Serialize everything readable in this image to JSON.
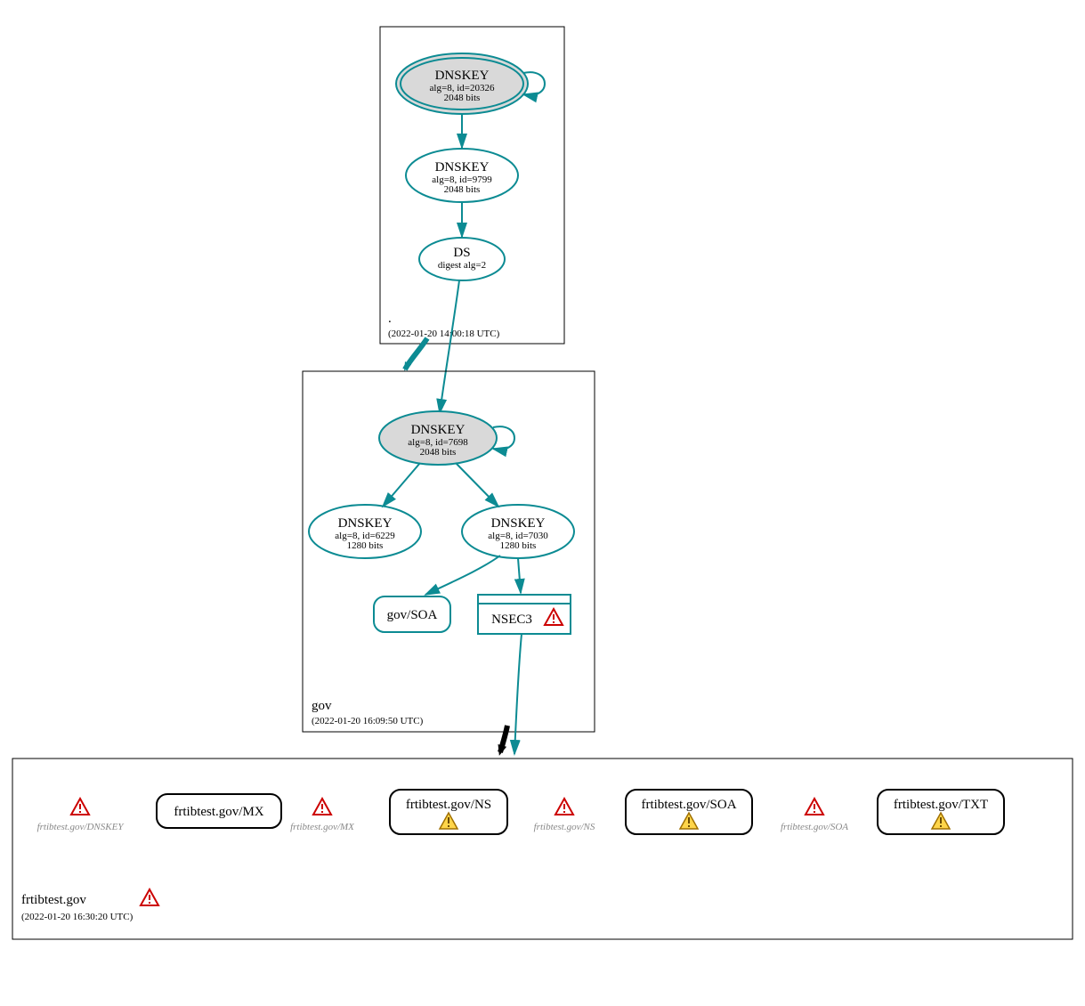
{
  "colors": {
    "teal": "#0c8b93",
    "greyFill": "#d9d9d9",
    "boxStroke": "#000000",
    "ghost": "#888888"
  },
  "zones": {
    "root": {
      "label": ".",
      "timestamp": "(2022-01-20 14:00:18 UTC)"
    },
    "gov": {
      "label": "gov",
      "timestamp": "(2022-01-20 16:09:50 UTC)"
    },
    "frtibtest": {
      "label": "frtibtest.gov",
      "timestamp": "(2022-01-20 16:30:20 UTC)"
    }
  },
  "nodes": {
    "root_ksk": {
      "title": "DNSKEY",
      "line1": "alg=8, id=20326",
      "line2": "2048 bits"
    },
    "root_zsk": {
      "title": "DNSKEY",
      "line1": "alg=8, id=9799",
      "line2": "2048 bits"
    },
    "root_ds": {
      "title": "DS",
      "line1": "digest alg=2"
    },
    "gov_ksk": {
      "title": "DNSKEY",
      "line1": "alg=8, id=7698",
      "line2": "2048 bits"
    },
    "gov_zsk1": {
      "title": "DNSKEY",
      "line1": "alg=8, id=6229",
      "line2": "1280 bits"
    },
    "gov_zsk2": {
      "title": "DNSKEY",
      "line1": "alg=8, id=7030",
      "line2": "1280 bits"
    },
    "gov_soa": {
      "title": "gov/SOA"
    },
    "gov_nsec3": {
      "title": "NSEC3"
    }
  },
  "bottom": {
    "ghost_dnskey": "frtibtest.gov/DNSKEY",
    "mx": "frtibtest.gov/MX",
    "ghost_mx": "frtibtest.gov/MX",
    "ns": "frtibtest.gov/NS",
    "ghost_ns": "frtibtest.gov/NS",
    "soa": "frtibtest.gov/SOA",
    "ghost_soa": "frtibtest.gov/SOA",
    "txt": "frtibtest.gov/TXT"
  }
}
